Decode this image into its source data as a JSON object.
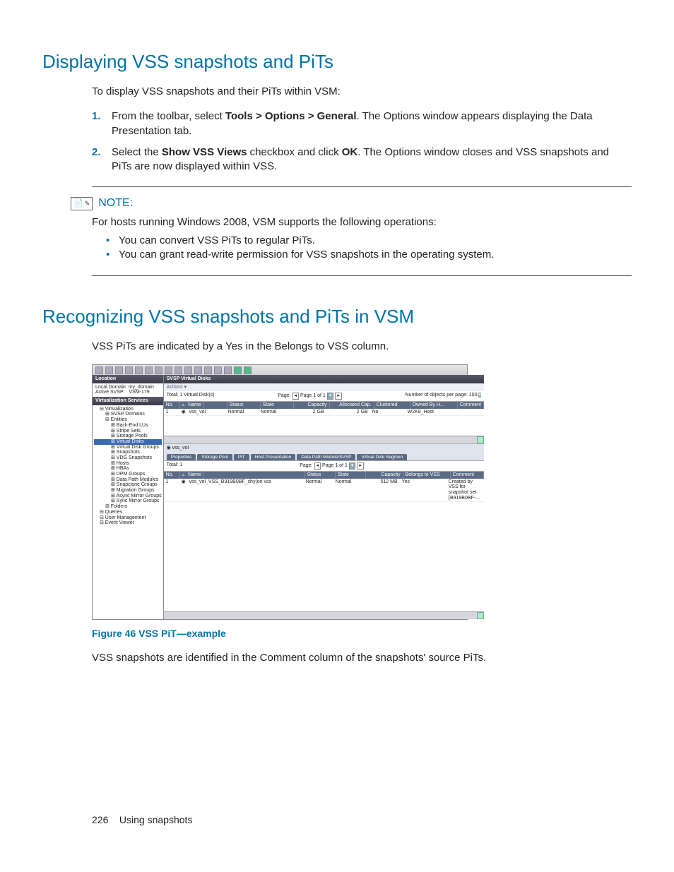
{
  "heading1": "Displaying VSS snapshots and PiTs",
  "intro1": "To display VSS snapshots and their PiTs within VSM:",
  "step1_pre": "From the toolbar, select ",
  "step1_bold": "Tools > Options > General",
  "step1_post": ". The Options window appears displaying the Data Presentation tab.",
  "step2_pre": "Select the ",
  "step2_bold1": "Show VSS Views",
  "step2_mid": " checkbox and click ",
  "step2_bold2": "OK",
  "step2_post": ". The Options window closes and VSS snapshots and PiTs are now displayed within VSS.",
  "note_label": "NOTE:",
  "note_intro": "For hosts running Windows 2008, VSM supports the following operations:",
  "note_b1": "You can convert VSS PiTs to regular PiTs.",
  "note_b2": "You can grant read-write permission for VSS snapshots in the operating system.",
  "heading2": "Recognizing VSS snapshots and PiTs in VSM",
  "intro2": "VSS PiTs are indicated by a Yes in the Belongs to VSS column.",
  "fig_cap": "Figure 46 VSS PiT—example",
  "after_fig": "VSS snapshots are identified in the Comment column of the snapshots' source PiTs.",
  "footer_page": "226",
  "footer_text": "Using snapshots",
  "ss": {
    "loc_hdr": "Location",
    "loc_domain_lbl": "Local Domain:",
    "loc_domain_val": "my_domain",
    "loc_svsp_lbl": "Active SVSP:",
    "loc_svsp_val": "VSM-179",
    "vs_hdr": "Virtualization Services",
    "tree": [
      "Virtualization",
      " SVSP Domains",
      " Entities",
      "  Back-End LUs",
      "  Stripe Sets",
      "  Storage Pools",
      "  Virtual Disks",
      "  Virtual Disk Groups",
      "  Snapshots",
      "  VDG Snapshots",
      "  Hosts",
      "  HBAs",
      "  DPM Groups",
      "  Data Path Modules",
      "  Snapclone Groups",
      "  Migration Groups",
      "  Async Mirror Groups",
      "  Sync Mirror Groups",
      " Folders",
      "Queries",
      "User Management",
      "Event Viewer"
    ],
    "tree_sel_idx": 6,
    "crumb": "SVSP Virtual Disks",
    "actions": "Actions ▾",
    "total_top": "Total: 1 Virtual Disk(s)",
    "page_lbl": "Page:",
    "page_info": "Page 1 of 1",
    "obj_lbl": "Number of objects per page:",
    "obj_val": "100",
    "thdr": [
      "No.",
      "Name",
      "Status",
      "State",
      "Capacity",
      "Allocated Cap.",
      "Clustered",
      "Owned By H...",
      "Comment"
    ],
    "row": [
      "1",
      "vss_vol",
      "Normal",
      "Normal",
      "2  GB",
      "2  GB",
      "No",
      "W2K8_Host",
      ""
    ],
    "sub_name": "vss_vol",
    "tabs": [
      "Properties",
      "Storage Pool",
      "PiT",
      "Host Presentation",
      "Data Path Module/SVSP",
      "Virtual Disk Segmen"
    ],
    "total_sub": "Total: 1",
    "dhdr": [
      "No.",
      "Name",
      "Status",
      "State",
      "Capacity",
      "Belongs to VSS",
      "Comment"
    ],
    "drow": [
      "1",
      "vss_vol_VSS_B919B0BF_shy(on vss",
      "Normal",
      "Normal",
      "512  MB",
      "Yes",
      "Created by VSS for snapshot set {B919B0BF-..."
    ]
  }
}
